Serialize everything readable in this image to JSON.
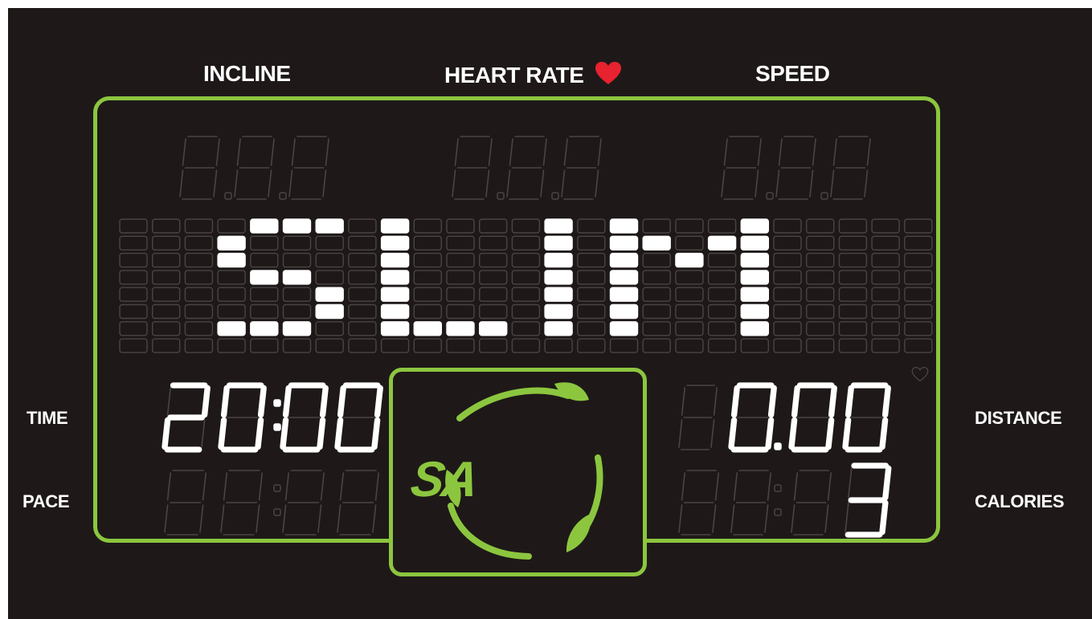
{
  "labels": {
    "incline": "INCLINE",
    "heart_rate": "HEART RATE",
    "speed": "SPEED",
    "time": "TIME",
    "pace": "PACE",
    "distance": "DISTANCE",
    "calories": "CALORIES"
  },
  "icons": {
    "heart_rate": "heart-icon",
    "heart_outline": "heart-outline-icon",
    "logo": "sa-logo"
  },
  "logo": {
    "text": "SA"
  },
  "matrix": {
    "message": "SLIM"
  },
  "readouts": {
    "incline": "",
    "heart_rate": "",
    "speed": "",
    "time": "20:00",
    "distance": "0.00",
    "pace": "",
    "calories": "3"
  },
  "colors": {
    "background": "#1e1918",
    "frame": "#8cc63f",
    "heart": "#e8222f",
    "lit": "#ffffff",
    "unlit": "#4a4544"
  }
}
